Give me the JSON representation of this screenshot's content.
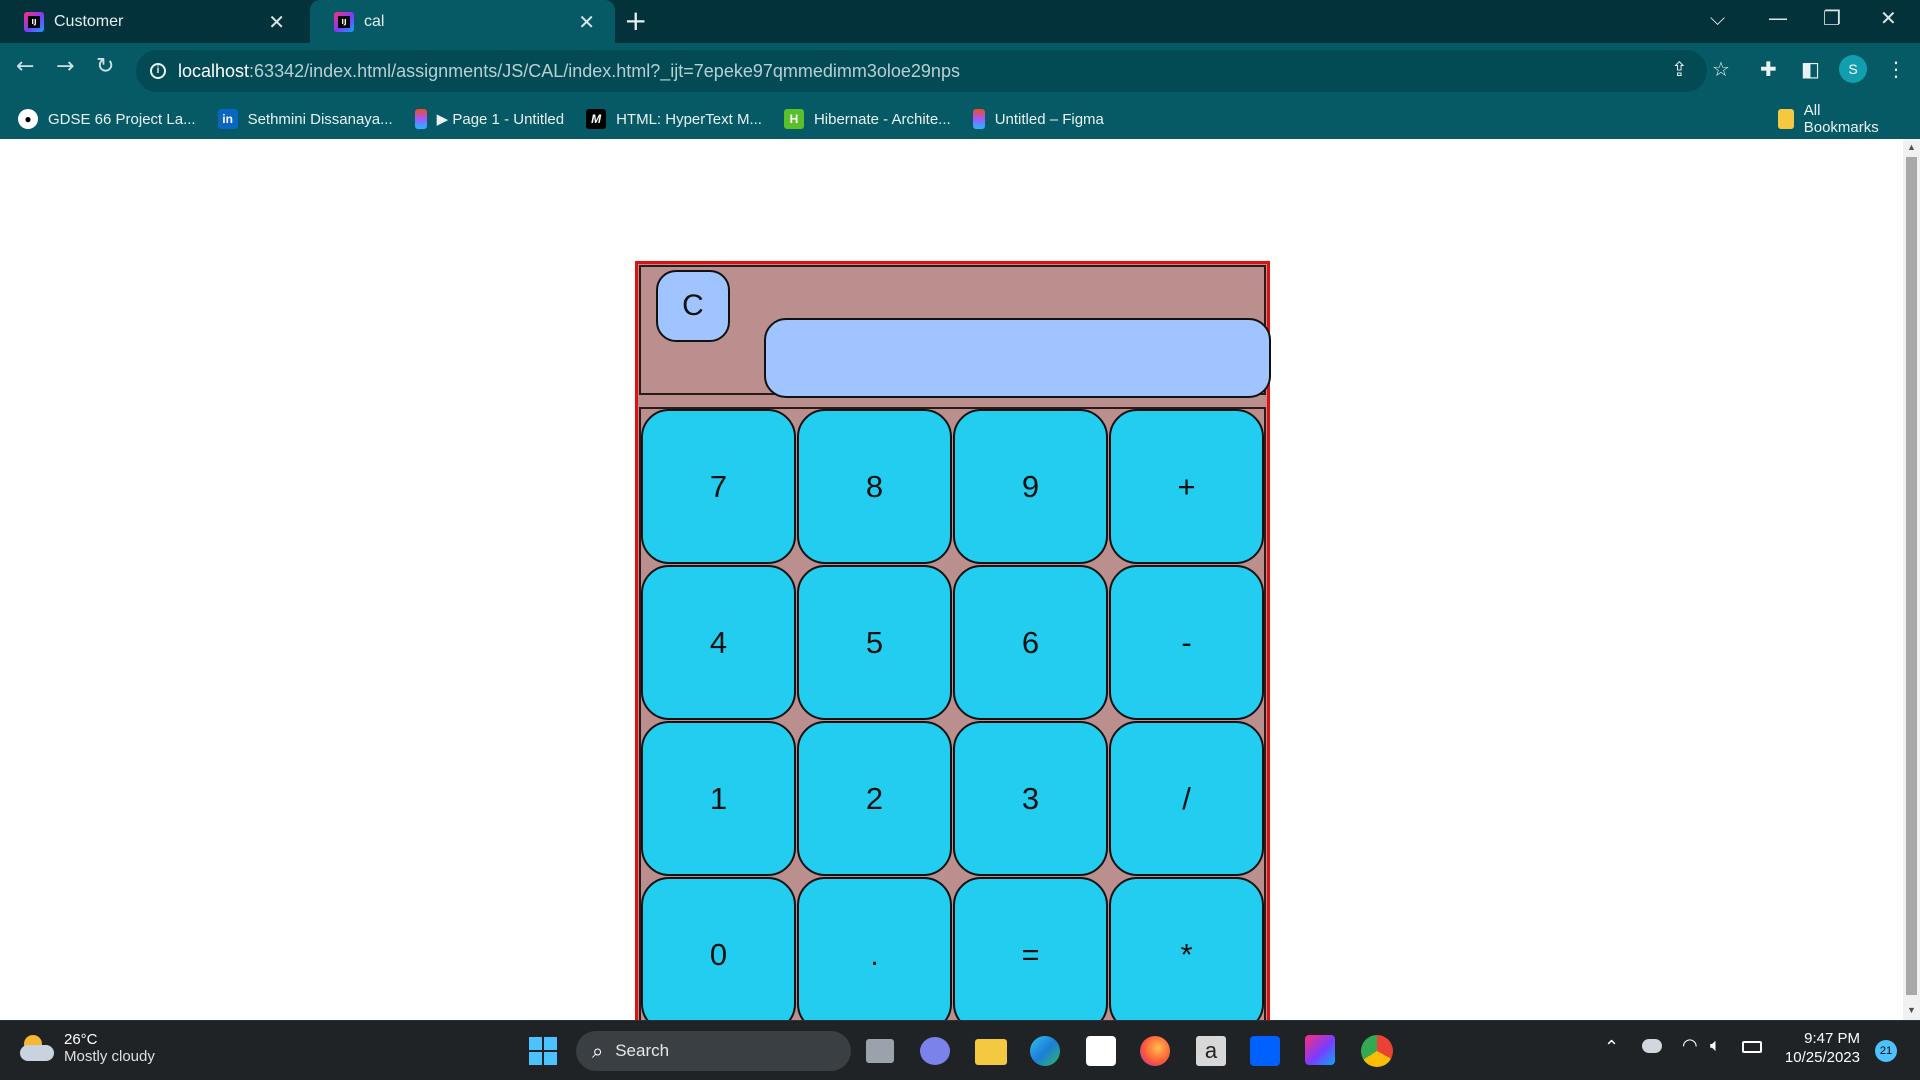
{
  "browser": {
    "tabs": [
      {
        "title": "Customer",
        "active": false
      },
      {
        "title": "cal",
        "active": true
      }
    ],
    "address": {
      "host": "localhost",
      "path": ":63342/index.html/assignments/JS/CAL/index.html?_ijt=7epeke97qmmedimm3oloe29nps"
    },
    "profile_initial": "S",
    "bookmarks": [
      {
        "label": "GDSE 66 Project La...",
        "icon": "github-icon"
      },
      {
        "label": "Sethmini Dissanaya...",
        "icon": "linkedin-icon"
      },
      {
        "label": "▶ Page 1 - Untitled",
        "icon": "figma-icon"
      },
      {
        "label": "HTML: HyperText M...",
        "icon": "mdn-icon"
      },
      {
        "label": "Hibernate - Archite...",
        "icon": "hibernate-icon"
      },
      {
        "label": "Untitled – Figma",
        "icon": "figma-icon"
      }
    ],
    "all_bookmarks_label": "All Bookmarks"
  },
  "calculator": {
    "clear_label": "C",
    "display_value": "",
    "keys": [
      "7",
      "8",
      "9",
      "+",
      "4",
      "5",
      "6",
      "-",
      "1",
      "2",
      "3",
      "/",
      "0",
      ".",
      "=",
      "*"
    ],
    "colors": {
      "body": "#bc8f8f",
      "border": "#e01010",
      "key": "#22cdef",
      "display": "#a0c4ff"
    }
  },
  "taskbar": {
    "weather": {
      "temp": "26°C",
      "condition": "Mostly cloudy"
    },
    "search_label": "Search",
    "clock": {
      "time": "9:47 PM",
      "date": "10/25/2023"
    },
    "notification_count": "21",
    "apps": [
      "task-view-icon",
      "teams-chat-icon",
      "file-explorer-icon",
      "edge-icon",
      "store-icon",
      "firefox-icon",
      "amazon-icon",
      "dropbox-icon",
      "intellij-icon",
      "chrome-icon"
    ]
  }
}
